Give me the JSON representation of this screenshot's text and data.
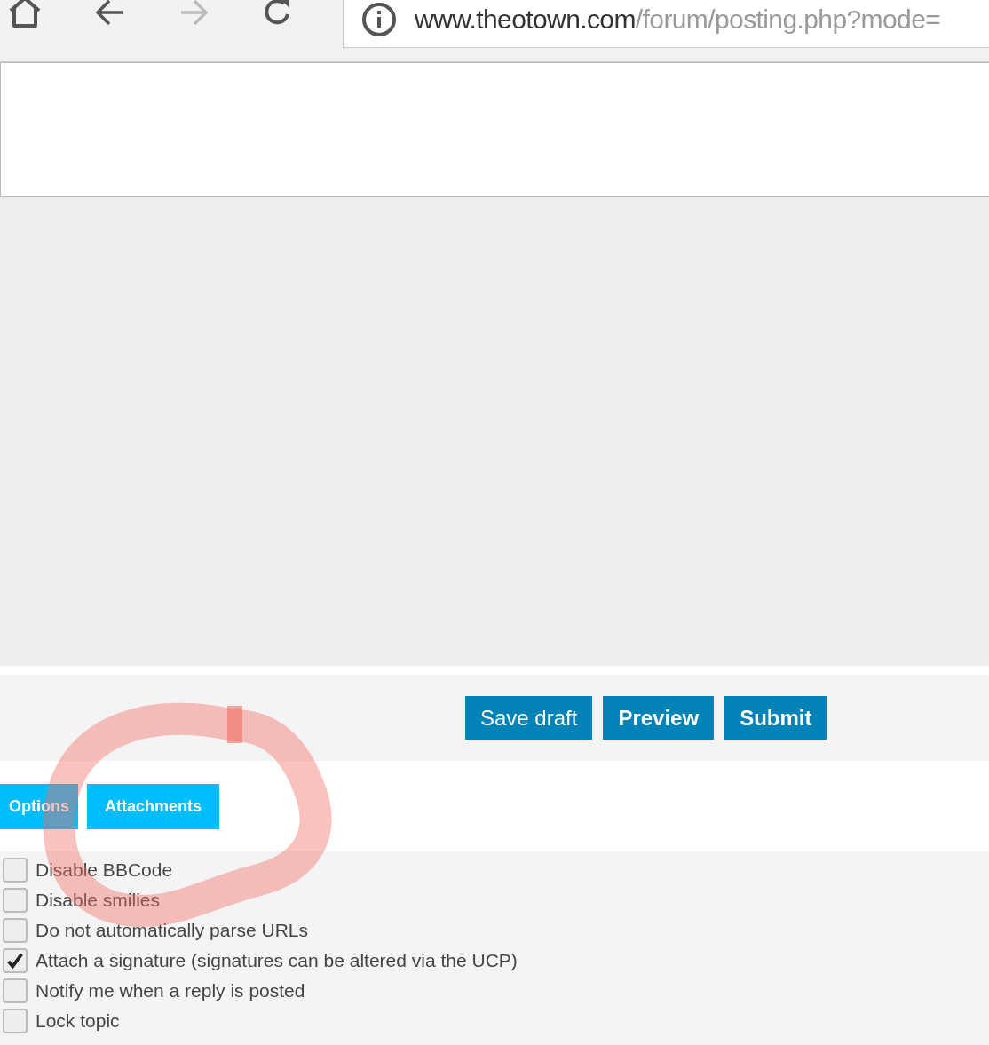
{
  "toolbar": {
    "url_host": "www.theotown.com",
    "url_path": "/forum/posting.php?mode="
  },
  "actions": [
    {
      "label": "Save draft",
      "kind": "normal"
    },
    {
      "label": "Preview",
      "kind": "bold"
    },
    {
      "label": "Submit",
      "kind": "bold"
    }
  ],
  "tabs": [
    {
      "label": "Options"
    },
    {
      "label": "Attachments"
    }
  ],
  "options": [
    {
      "label": "Disable BBCode",
      "checked": false
    },
    {
      "label": "Disable smilies",
      "checked": false
    },
    {
      "label": "Do not automatically parse URLs",
      "checked": false
    },
    {
      "label": "Attach a signature (signatures can be altered via the UCP)",
      "checked": true
    },
    {
      "label": "Notify me when a reply is posted",
      "checked": false
    },
    {
      "label": "Lock topic",
      "checked": false
    }
  ]
}
